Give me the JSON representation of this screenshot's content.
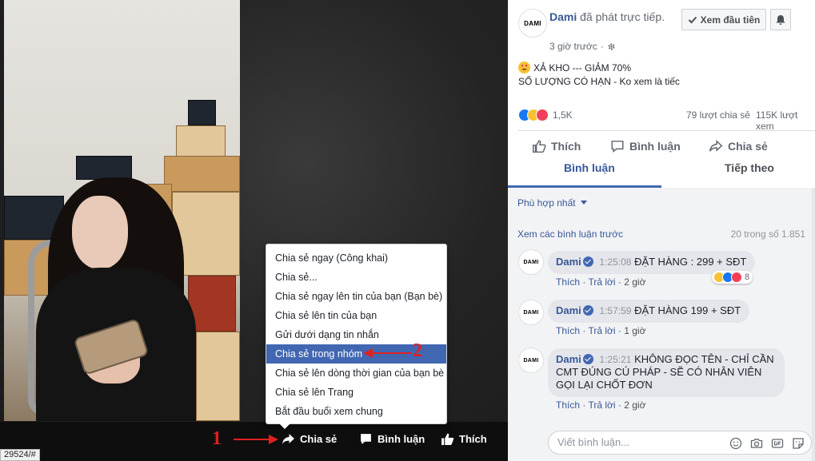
{
  "video": {
    "url_tooltip": "29524/#",
    "actions": {
      "share": "Chia sẻ",
      "comment": "Bình luận",
      "like": "Thích"
    },
    "annotations": {
      "marker_1": "1",
      "marker_2": "2"
    },
    "share_menu": {
      "items": [
        "Chia sẻ ngay (Công khai)",
        "Chia sẻ...",
        "Chia sẻ ngay lên tin của bạn (Bạn bè)",
        "Chia sẻ lên tin của bạn",
        "Gửi dưới dạng tin nhắn",
        "Chia sẻ trong nhóm",
        "Chia sẻ lên dòng thời gian của bạn bè",
        "Chia sẻ lên Trang",
        "Bắt đầu buổi xem chung"
      ],
      "highlighted_index": 5
    }
  },
  "post": {
    "avatar_text": "DAMI",
    "page_name": "Dami",
    "action_text": " đã phát trực tiếp.",
    "time": "3 giờ trước",
    "follow_first_label": "Xem đầu tiên",
    "line1": "XẢ KHO --- GIẢM 70%",
    "line2": "SỐ LƯỢNG CÓ HẠN - Ko xem là tiếc",
    "reaction_count": "1,5K",
    "shares": "79 lượt chia sẻ",
    "views": "115K lượt xem",
    "actions": {
      "like": "Thích",
      "comment": "Bình luận",
      "share": "Chia sẻ"
    },
    "tabs": {
      "comments": "Bình luận",
      "up_next": "Tiếp theo"
    }
  },
  "comments": {
    "sort_label": "Phù hợp nhất",
    "view_previous": "Xem các bình luận trước",
    "count": "20 trong số 1.851",
    "items": [
      {
        "author": "Dami",
        "timestamp": "1:25:08",
        "text": "ĐẶT HÀNG : 299 + SĐT",
        "like": "Thích",
        "reply": "Trả lời",
        "time": "2 giờ",
        "reactions": "8"
      },
      {
        "author": "Dami",
        "timestamp": "1:57:59",
        "text": "ĐẶT HÀNG 199 + SĐT",
        "like": "Thích",
        "reply": "Trả lời",
        "time": "1 giờ"
      },
      {
        "author": "Dami",
        "timestamp": "1:25:21",
        "text": "KHÔNG ĐỌC TÊN - CHỈ CẦN CMT ĐÚNG CÚ PHÁP - SẼ CÓ NHÂN VIÊN GỌI LẠI CHỐT ĐƠN",
        "like": "Thích",
        "reply": "Trả lời",
        "time": "2 giờ"
      }
    ],
    "compose_placeholder": "Viết bình luận..."
  },
  "colors": {
    "facebook_blue": "#4267b2",
    "link": "#385898",
    "annotation_red": "#e02020"
  }
}
